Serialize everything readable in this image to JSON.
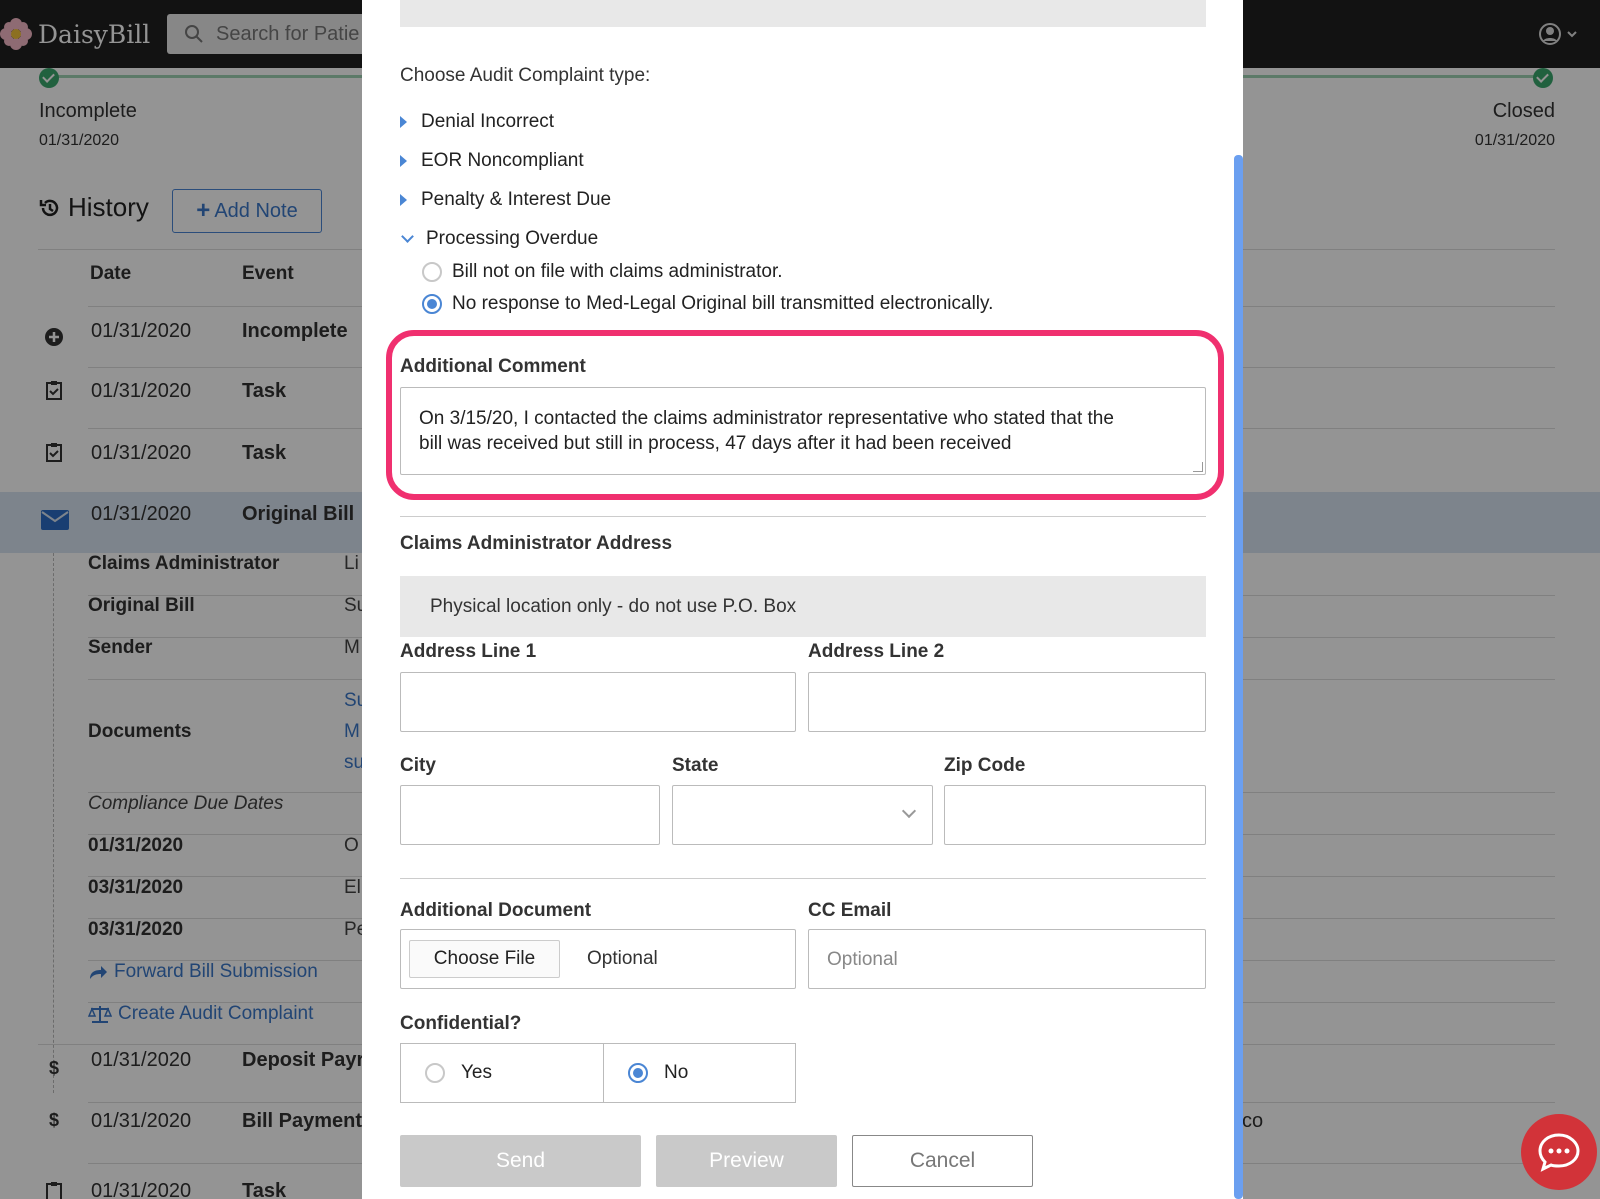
{
  "app": {
    "name": "DaisyBill"
  },
  "search": {
    "placeholder": "Search for Patie"
  },
  "progress": {
    "start": {
      "label": "Incomplete",
      "date": "01/31/2020"
    },
    "end": {
      "label": "Closed",
      "date": "01/31/2020"
    }
  },
  "history": {
    "title": "History",
    "add_note": "Add Note",
    "columns": {
      "date": "Date",
      "event": "Event"
    },
    "rows": [
      {
        "icon": "plus-circle-icon",
        "date": "01/31/2020",
        "event": "Incomplete"
      },
      {
        "icon": "clipboard-check-icon",
        "date": "01/31/2020",
        "event": "Task"
      },
      {
        "icon": "clipboard-check-icon",
        "date": "01/31/2020",
        "event": "Task"
      },
      {
        "icon": "envelope-icon",
        "date": "01/31/2020",
        "event": "Original Bill"
      }
    ],
    "details": [
      {
        "label": "Claims Administrator",
        "value": "Li"
      },
      {
        "label": "Original Bill",
        "value": "Su"
      },
      {
        "label": "Sender",
        "value": "M"
      },
      {
        "label": "Documents",
        "values": [
          "Su",
          "M",
          "su"
        ]
      }
    ],
    "compliance_title": "Compliance Due Dates",
    "compliance": [
      {
        "date": "01/31/2020",
        "value": "O"
      },
      {
        "date": "03/31/2020",
        "value": "El"
      },
      {
        "date": "03/31/2020",
        "value": "Pe"
      }
    ],
    "links": {
      "forward": "Forward Bill Submission",
      "audit": "Create Audit Complaint"
    },
    "later_rows": [
      {
        "icon": "dollar-hand-icon",
        "date": "01/31/2020",
        "event": "Deposit Payr"
      },
      {
        "icon": "dollar-icon",
        "date": "01/31/2020",
        "event": "Bill Payment",
        "extra": "co"
      },
      {
        "icon": "clipboard-check-icon",
        "date": "01/31/2020",
        "event": "Task"
      }
    ]
  },
  "modal": {
    "complaint_type_heading": "Choose Audit Complaint type:",
    "types": [
      {
        "label": "Denial Incorrect",
        "expanded": false
      },
      {
        "label": "EOR Noncompliant",
        "expanded": false
      },
      {
        "label": "Penalty & Interest Due",
        "expanded": false
      },
      {
        "label": "Processing Overdue",
        "expanded": true
      }
    ],
    "options": [
      {
        "label": "Bill not on file with claims administrator.",
        "selected": false
      },
      {
        "label": "No response to Med-Legal Original bill transmitted electronically.",
        "selected": true
      }
    ],
    "comment_label": "Additional Comment",
    "comment_line1": "On 3/15/20, I contacted the claims administrator representative who stated that the",
    "comment_line2": "bill was received but still in process, 47 days after it had been received",
    "address_heading": "Claims Administrator Address",
    "address_notice": "Physical location only - do not use P.O. Box",
    "address_line1_label": "Address Line 1",
    "address_line2_label": "Address Line 2",
    "city_label": "City",
    "state_label": "State",
    "zip_label": "Zip Code",
    "doc_label": "Additional Document",
    "choose_file": "Choose File",
    "doc_placeholder": "Optional",
    "cc_label": "CC Email",
    "cc_placeholder": "Optional",
    "confidential_label": "Confidential?",
    "yes": "Yes",
    "no": "No",
    "confidential_value": "No",
    "send": "Send",
    "preview": "Preview",
    "cancel": "Cancel"
  },
  "colors": {
    "accent": "#4a86d4",
    "highlight": "#f0306f",
    "topbar": "#1f1f1f",
    "chat": "#d23339"
  }
}
